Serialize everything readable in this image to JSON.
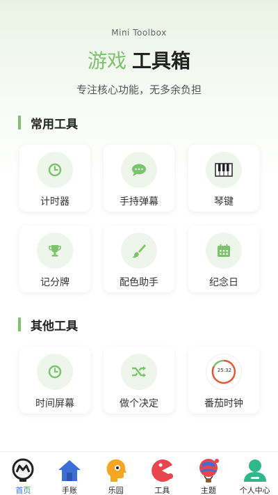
{
  "header": {
    "subtitle": "Mini Toolbox",
    "title_accent": "游戏",
    "title_main": "工具箱",
    "tagline": "专注核心功能，无多余负担"
  },
  "sections": [
    {
      "title": "常用工具",
      "tools": [
        {
          "label": "计时器",
          "icon": "clock-icon"
        },
        {
          "label": "手持弹幕",
          "icon": "chat-bubble-icon"
        },
        {
          "label": "琴键",
          "icon": "piano-keys-icon"
        },
        {
          "label": "记分牌",
          "icon": "trophy-icon"
        },
        {
          "label": "配色助手",
          "icon": "paintbrush-icon"
        },
        {
          "label": "纪念日",
          "icon": "calendar-icon"
        }
      ]
    },
    {
      "title": "其他工具",
      "tools": [
        {
          "label": "时间屏幕",
          "icon": "clock-icon"
        },
        {
          "label": "做个决定",
          "icon": "shuffle-icon"
        },
        {
          "label": "番茄时钟",
          "icon": "pomodoro-timer-icon",
          "display": "25:32"
        }
      ]
    }
  ],
  "tabbar": {
    "items": [
      {
        "label": "首页",
        "icon": "home-lamp-icon",
        "active": true
      },
      {
        "label": "手账",
        "icon": "house-icon",
        "active": false
      },
      {
        "label": "乐园",
        "icon": "head-icon",
        "active": false
      },
      {
        "label": "工具",
        "icon": "pacman-icon",
        "active": false
      },
      {
        "label": "主题",
        "icon": "hot-air-balloon-icon",
        "active": false
      },
      {
        "label": "个人中心",
        "icon": "user-icon",
        "active": false
      }
    ]
  },
  "colors": {
    "accent": "#7cc36d",
    "icon_bg": "#eef5ea",
    "tab_active": "#3a7bd5"
  }
}
